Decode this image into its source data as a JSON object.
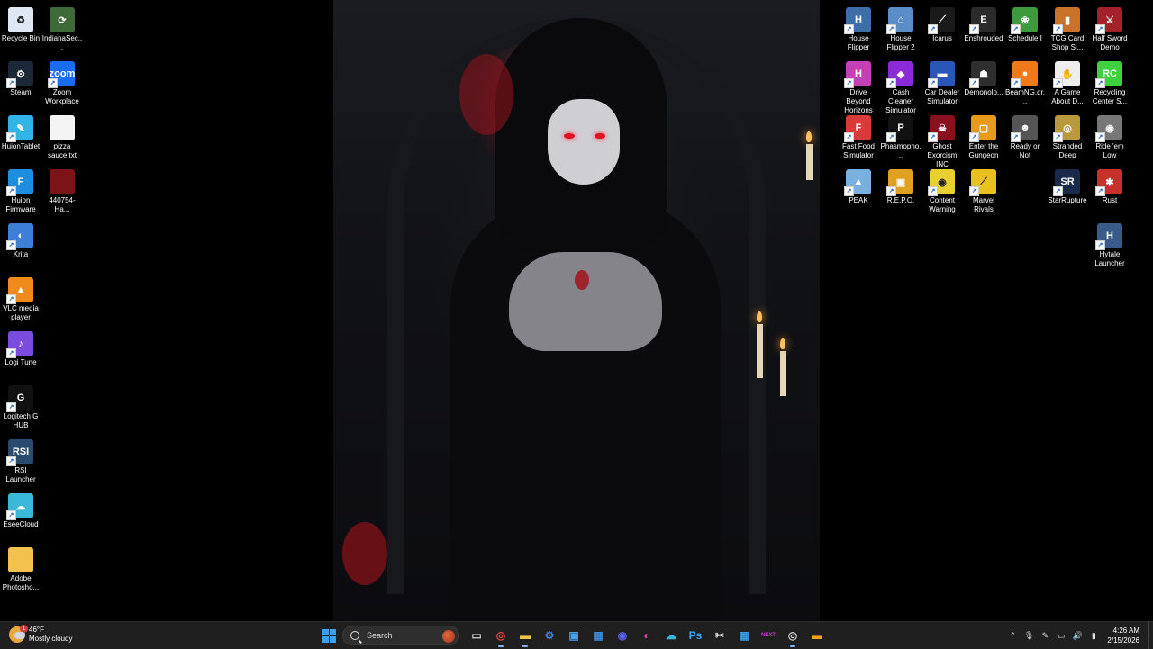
{
  "desktop": {
    "left_icons": [
      {
        "label": "Recycle Bin",
        "icon": "recycle-bin-icon",
        "color": "#dfe8f2",
        "glyph": "♻",
        "shortcut": false
      },
      {
        "label": "IndianaSec...",
        "icon": "indiana-icon",
        "color": "#3e6a3a",
        "glyph": "⟳",
        "shortcut": false
      },
      {
        "label": "Steam",
        "icon": "steam-icon",
        "color": "#1b2838",
        "glyph": "⚙",
        "shortcut": true
      },
      {
        "label": "Zoom Workplace",
        "icon": "zoom-icon",
        "color": "#1a6cf0",
        "glyph": "zoom",
        "shortcut": true
      },
      {
        "label": "HuionTablet",
        "icon": "huion-tablet-icon",
        "color": "#33b4e8",
        "glyph": "✎",
        "shortcut": true
      },
      {
        "label": "pizza sauce.txt",
        "icon": "text-file-icon",
        "color": "#f4f4f4",
        "glyph": "",
        "shortcut": false
      },
      {
        "label": "Huion Firmware",
        "icon": "huion-firmware-icon",
        "color": "#1d8de0",
        "glyph": "F",
        "shortcut": true
      },
      {
        "label": "440754-Ha...",
        "icon": "image-file-icon",
        "color": "#7a1418",
        "glyph": "",
        "shortcut": false
      },
      {
        "label": "Krita",
        "icon": "krita-icon",
        "color": "#3c7ed8",
        "glyph": "◐",
        "shortcut": true
      },
      {
        "label": "VLC media player",
        "icon": "vlc-icon",
        "color": "#f08a1a",
        "glyph": "▲",
        "shortcut": true
      },
      {
        "label": "Logi Tune",
        "icon": "logi-tune-icon",
        "color": "#7b4be0",
        "glyph": "♪",
        "shortcut": true
      },
      {
        "label": "Logitech G HUB",
        "icon": "logitech-ghub-icon",
        "color": "#111111",
        "glyph": "G",
        "shortcut": true
      },
      {
        "label": "RSI Launcher",
        "icon": "rsi-launcher-icon",
        "color": "#2a4b70",
        "glyph": "RSI",
        "shortcut": true
      },
      {
        "label": "EseeCloud",
        "icon": "eseecloud-icon",
        "color": "#3ab8d8",
        "glyph": "☁",
        "shortcut": true
      },
      {
        "label": "Adobe Photosho...",
        "icon": "folder-icon",
        "color": "#f2c14e",
        "glyph": "",
        "shortcut": false
      }
    ],
    "right_icons": [
      {
        "label": "House Flipper",
        "icon": "house-flipper-icon",
        "color": "#3d6ea8",
        "glyph": "H",
        "shortcut": true
      },
      {
        "label": "House Flipper 2",
        "icon": "house-flipper-2-icon",
        "color": "#5a8cc8",
        "glyph": "⌂",
        "shortcut": true
      },
      {
        "label": "Icarus",
        "icon": "icarus-icon",
        "color": "#1a1a1a",
        "glyph": "⟋",
        "shortcut": true
      },
      {
        "label": "Enshrouded",
        "icon": "enshrouded-icon",
        "color": "#2b2b2b",
        "glyph": "E",
        "shortcut": true
      },
      {
        "label": "Schedule I",
        "icon": "schedule-i-icon",
        "color": "#3e9a3e",
        "glyph": "❀",
        "shortcut": true
      },
      {
        "label": "TCG Card Shop Si...",
        "icon": "tcg-card-shop-icon",
        "color": "#c8722a",
        "glyph": "▮",
        "shortcut": true
      },
      {
        "label": "Half Sword Demo",
        "icon": "half-sword-icon",
        "color": "#a3222a",
        "glyph": "⚔",
        "shortcut": true
      },
      {
        "label": "Drive Beyond Horizons",
        "icon": "drive-beyond-horizons-icon",
        "color": "#c43fb8",
        "glyph": "H",
        "shortcut": true
      },
      {
        "label": "Cash Cleaner Simulator",
        "icon": "cash-cleaner-icon",
        "color": "#8a2ad8",
        "glyph": "◆",
        "shortcut": true
      },
      {
        "label": "Car Dealer Simulator",
        "icon": "car-dealer-icon",
        "color": "#2a56b8",
        "glyph": "▬",
        "shortcut": true
      },
      {
        "label": "Demonolo...",
        "icon": "demonologist-icon",
        "color": "#2e2e2e",
        "glyph": "☗",
        "shortcut": true
      },
      {
        "label": "BeamNG.dr...",
        "icon": "beamng-icon",
        "color": "#f07a1a",
        "glyph": "●",
        "shortcut": true
      },
      {
        "label": "A Game About D...",
        "icon": "a-game-about-icon",
        "color": "#eeeeee",
        "glyph": "✋",
        "shortcut": true
      },
      {
        "label": "Recycling Center S...",
        "icon": "recycling-center-icon",
        "color": "#3fd03f",
        "glyph": "RC",
        "shortcut": true
      },
      {
        "label": "Fast Food Simulator",
        "icon": "fast-food-icon",
        "color": "#d83a3a",
        "glyph": "F",
        "shortcut": true
      },
      {
        "label": "Phasmopho...",
        "icon": "phasmophobia-icon",
        "color": "#111111",
        "glyph": "P",
        "shortcut": true
      },
      {
        "label": "Ghost Exorcism INC",
        "icon": "ghost-exorcism-icon",
        "color": "#8a1020",
        "glyph": "☠",
        "shortcut": true
      },
      {
        "label": "Enter the Gungeon",
        "icon": "enter-gungeon-icon",
        "color": "#e89a1a",
        "glyph": "▢",
        "shortcut": true
      },
      {
        "label": "Ready or Not",
        "icon": "ready-or-not-icon",
        "color": "#555555",
        "glyph": "☻",
        "shortcut": true
      },
      {
        "label": "Stranded Deep",
        "icon": "stranded-deep-icon",
        "color": "#b89a3a",
        "glyph": "◎",
        "shortcut": true
      },
      {
        "label": "Ride 'em Low",
        "icon": "ride-em-low-icon",
        "color": "#777777",
        "glyph": "◉",
        "shortcut": true
      },
      {
        "label": "PEAK",
        "icon": "peak-icon",
        "color": "#7ab0e0",
        "glyph": "▲",
        "shortcut": true
      },
      {
        "label": "R.E.P.O.",
        "icon": "repo-icon",
        "color": "#e0a020",
        "glyph": "▣",
        "shortcut": true
      },
      {
        "label": "Content Warning",
        "icon": "content-warning-icon",
        "color": "#e8d030",
        "glyph": "◉",
        "shortcut": true
      },
      {
        "label": "Marvel Rivals",
        "icon": "marvel-rivals-icon",
        "color": "#e8c020",
        "glyph": "⟋",
        "shortcut": true
      },
      {
        "label": "StarRupture",
        "icon": "starrupture-icon",
        "color": "#1a2a4a",
        "glyph": "SR",
        "shortcut": true
      },
      {
        "label": "Rust",
        "icon": "rust-icon",
        "color": "#c8302a",
        "glyph": "✱",
        "shortcut": true
      },
      {
        "label": "Hytale Launcher",
        "icon": "hytale-icon",
        "color": "#3a5a8a",
        "glyph": "H",
        "shortcut": true
      }
    ]
  },
  "taskbar": {
    "weather": {
      "temp": "46°F",
      "condition": "Mostly cloudy",
      "badge": "1"
    },
    "search": {
      "placeholder": "Search"
    },
    "pinned": [
      {
        "name": "task-view-icon",
        "color": "#cfcfcf",
        "glyph": "▭",
        "active": false
      },
      {
        "name": "chrome-icon",
        "color": "#e8453c",
        "glyph": "◎",
        "active": true
      },
      {
        "name": "file-explorer-icon",
        "color": "#f2c14e",
        "glyph": "▬",
        "active": true
      },
      {
        "name": "steam-taskbar-icon",
        "color": "#3a7ad8",
        "glyph": "⚙",
        "active": false
      },
      {
        "name": "photos-icon",
        "color": "#4aa0e8",
        "glyph": "▣",
        "active": false
      },
      {
        "name": "image-viewer-icon",
        "color": "#3a8ad8",
        "glyph": "▦",
        "active": false
      },
      {
        "name": "discord-icon",
        "color": "#5865f2",
        "glyph": "◉",
        "active": false
      },
      {
        "name": "krita-taskbar-icon",
        "color": "#d04ab0",
        "glyph": "◐",
        "active": false
      },
      {
        "name": "eseecloud-taskbar-icon",
        "color": "#3ab8d8",
        "glyph": "☁",
        "active": false
      },
      {
        "name": "photoshop-icon",
        "color": "#31a8ff",
        "glyph": "Ps",
        "active": false
      },
      {
        "name": "capcut-icon",
        "color": "#dddddd",
        "glyph": "✂",
        "active": false
      },
      {
        "name": "microsoft-store-icon",
        "color": "#3a9ae8",
        "glyph": "▦",
        "active": false
      },
      {
        "name": "next-app-icon",
        "color": "#c83ad8",
        "glyph": "NEXT",
        "active": false
      },
      {
        "name": "obs-icon",
        "color": "#cccccc",
        "glyph": "◎",
        "active": true
      },
      {
        "name": "sticky-app-icon",
        "color": "#f0a020",
        "glyph": "▬",
        "active": false
      }
    ],
    "tray": {
      "icons": [
        "chevron-up-icon",
        "microphone-icon",
        "pen-icon",
        "network-icon",
        "volume-icon",
        "battery-icon"
      ],
      "time": "4:26 AM",
      "date": "2/15/2026"
    }
  }
}
